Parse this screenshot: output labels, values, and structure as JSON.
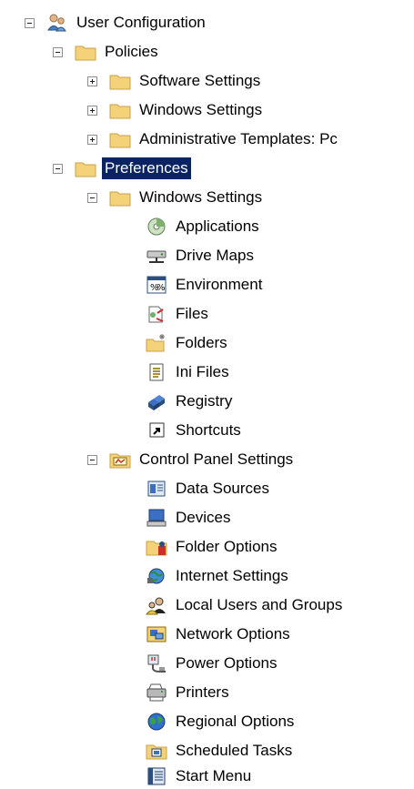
{
  "tree": {
    "root": {
      "label": "User Configuration",
      "icon": "user-config-icon",
      "expanded": true
    },
    "policies": {
      "label": "Policies",
      "icon": "folder-icon",
      "expanded": true,
      "children": [
        {
          "label": "Software Settings",
          "icon": "folder-icon",
          "expanded": false
        },
        {
          "label": "Windows Settings",
          "icon": "folder-icon",
          "expanded": false
        },
        {
          "label": "Administrative Templates: Pc",
          "icon": "folder-icon",
          "expanded": false
        }
      ]
    },
    "preferences": {
      "label": "Preferences",
      "icon": "folder-icon",
      "expanded": true,
      "selected": true,
      "windows_settings": {
        "label": "Windows Settings",
        "icon": "folder-icon",
        "expanded": true,
        "children": [
          {
            "label": "Applications",
            "icon": "applications-icon"
          },
          {
            "label": "Drive Maps",
            "icon": "drive-maps-icon"
          },
          {
            "label": "Environment",
            "icon": "environment-icon"
          },
          {
            "label": "Files",
            "icon": "files-icon"
          },
          {
            "label": "Folders",
            "icon": "folders-icon"
          },
          {
            "label": "Ini Files",
            "icon": "ini-files-icon"
          },
          {
            "label": "Registry",
            "icon": "registry-icon"
          },
          {
            "label": "Shortcuts",
            "icon": "shortcuts-icon"
          }
        ]
      },
      "control_panel": {
        "label": "Control Panel Settings",
        "icon": "control-panel-icon",
        "expanded": true,
        "children": [
          {
            "label": "Data Sources",
            "icon": "data-sources-icon"
          },
          {
            "label": "Devices",
            "icon": "devices-icon"
          },
          {
            "label": "Folder Options",
            "icon": "folder-options-icon"
          },
          {
            "label": "Internet Settings",
            "icon": "internet-settings-icon"
          },
          {
            "label": "Local Users and Groups",
            "icon": "local-users-icon"
          },
          {
            "label": "Network Options",
            "icon": "network-options-icon"
          },
          {
            "label": "Power Options",
            "icon": "power-options-icon"
          },
          {
            "label": "Printers",
            "icon": "printers-icon"
          },
          {
            "label": "Regional Options",
            "icon": "regional-options-icon"
          },
          {
            "label": "Scheduled Tasks",
            "icon": "scheduled-tasks-icon"
          },
          {
            "label": "Start Menu",
            "icon": "start-menu-icon"
          }
        ]
      }
    }
  },
  "colors": {
    "selection": "#0a2463",
    "folder": "#f3d27a",
    "folder_edge": "#c9a24a"
  }
}
